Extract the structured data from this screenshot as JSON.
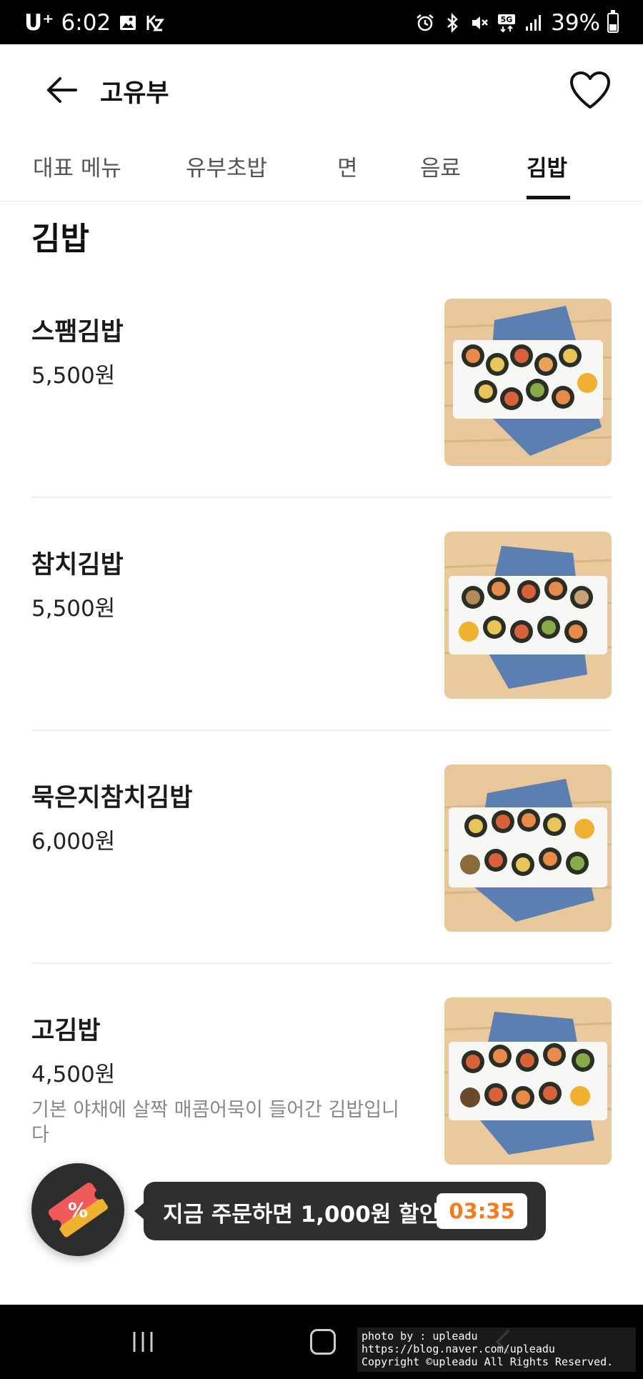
{
  "status_bar": {
    "carrier": "U⁺",
    "time": "6:02",
    "battery": "39%",
    "network": "5G",
    "battery_level": 0.39
  },
  "header": {
    "title": "고유부"
  },
  "tabs": [
    {
      "label": "대표 메뉴",
      "active": false
    },
    {
      "label": "유부초밥",
      "active": false
    },
    {
      "label": "면",
      "active": false
    },
    {
      "label": "음료",
      "active": false
    },
    {
      "label": "김밥",
      "active": true
    }
  ],
  "section": {
    "title": "김밥"
  },
  "items": [
    {
      "name": "스팸김밥",
      "price": "5,500원",
      "description": ""
    },
    {
      "name": "참치김밥",
      "price": "5,500원",
      "description": ""
    },
    {
      "name": "묵은지참치김밥",
      "price": "6,000원",
      "description": ""
    },
    {
      "name": "고김밥",
      "price": "4,500원",
      "description": "기본 야채에 살짝 매콤어묵이 들어간 김밥입니다"
    }
  ],
  "promo": {
    "icon_label": "%",
    "message": "지금 주문하면 1,000원 할인!",
    "timer": "03:35"
  },
  "watermark": {
    "line1": "photo by : upleadu",
    "line2": "https://blog.naver.com/upleadu",
    "line3": "Copyright ©upleadu All Rights Reserved."
  },
  "colors": {
    "accent_orange": "#f47a20",
    "dark": "#2f2f2f",
    "text_muted": "#888888"
  }
}
